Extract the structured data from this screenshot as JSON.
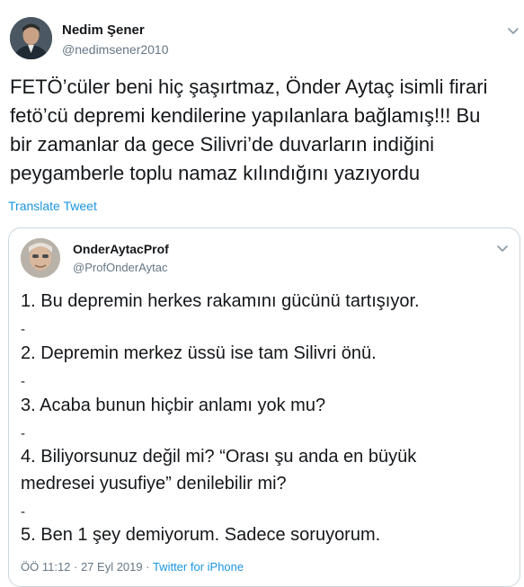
{
  "tweet": {
    "author_name": "Nedim Şener",
    "author_handle": "@nedimsener2010",
    "text_lines": [
      "FETÖ’cüler beni hiç şaşırtmaz, Önder Aytaç isimli firari",
      "fetö’cü depremi kendilerine yapılanlara bağlamış!!! Bu",
      "bir zamanlar da gece Silivri’de duvarların indiğini",
      "peygamberle toplu namaz kılındığını yazıyordu"
    ],
    "translate_label": "Translate Tweet",
    "avatar_icon": "profile-photo",
    "menu_icon": "chevron-down-icon"
  },
  "quoted_tweet": {
    "author_name": "OnderAytacProf",
    "author_handle": "@ProfOnderAytac",
    "lines": [
      "1. Bu depremin herkes rakamını gücünü tartışıyor.",
      "-",
      "2. Depremin merkez üssü ise tam Silivri önü.",
      "-",
      "3. Acaba bunun hiçbir anlamı yok mu?",
      "-",
      "4. Biliyorsunuz değil mi? “Orası şu anda en büyük",
      "medresei yusufiye” denilebilir mi?",
      "-",
      "5. Ben 1 şey demiyorum. Sadece soruyorum."
    ],
    "timestamp": "ÖÖ 11:12 · 27 Eyl 2019",
    "separator": " · ",
    "source": "Twitter for iPhone"
  },
  "colors": {
    "text": "#14171a",
    "secondary": "#657786",
    "link": "#1b95e0",
    "border": "#ccd6dd"
  }
}
